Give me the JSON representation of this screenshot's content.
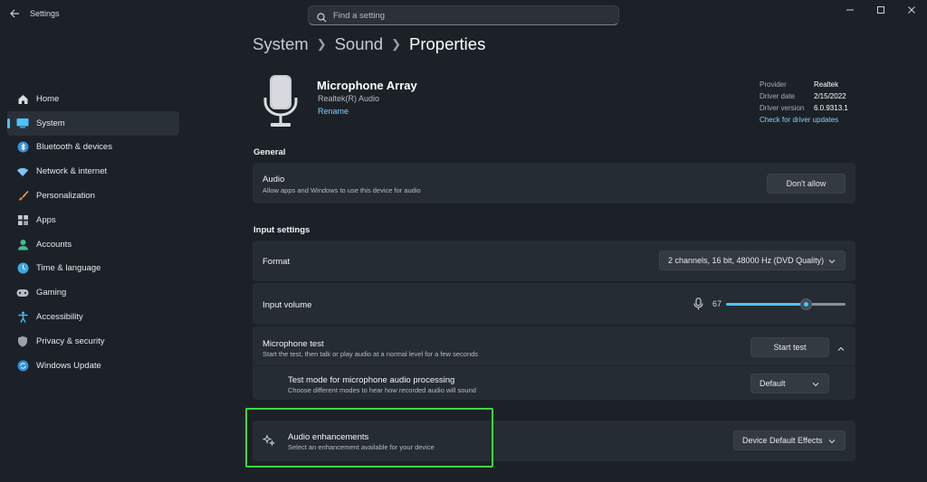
{
  "app": {
    "title": "Settings"
  },
  "search": {
    "placeholder": "Find a setting"
  },
  "sidebar": {
    "items": [
      {
        "label": "Home",
        "icon": "home-icon"
      },
      {
        "label": "System",
        "icon": "system-icon",
        "active": true
      },
      {
        "label": "Bluetooth & devices",
        "icon": "bluetooth-icon"
      },
      {
        "label": "Network & internet",
        "icon": "wifi-icon"
      },
      {
        "label": "Personalization",
        "icon": "brush-icon"
      },
      {
        "label": "Apps",
        "icon": "apps-icon"
      },
      {
        "label": "Accounts",
        "icon": "accounts-icon"
      },
      {
        "label": "Time & language",
        "icon": "globe-clock-icon"
      },
      {
        "label": "Gaming",
        "icon": "gamepad-icon"
      },
      {
        "label": "Accessibility",
        "icon": "accessibility-icon"
      },
      {
        "label": "Privacy & security",
        "icon": "shield-icon"
      },
      {
        "label": "Windows Update",
        "icon": "update-icon"
      }
    ]
  },
  "breadcrumb": [
    "System",
    "Sound",
    "Properties"
  ],
  "device": {
    "name": "Microphone Array",
    "driver_name": "Realtek(R) Audio",
    "rename_label": "Rename",
    "provider_label": "Provider",
    "provider_value": "Realtek",
    "date_label": "Driver date",
    "date_value": "2/15/2022",
    "version_label": "Driver version",
    "version_value": "6.0.9313.1",
    "update_link": "Check for driver updates"
  },
  "general": {
    "heading": "General",
    "audio_title": "Audio",
    "audio_desc": "Allow apps and Windows to use this device for audio",
    "audio_button": "Don't allow"
  },
  "input": {
    "heading": "Input settings",
    "format_title": "Format",
    "format_value": "2 channels, 16 bit, 48000 Hz (DVD Quality)",
    "volume_title": "Input volume",
    "volume_value": "67",
    "volume_level": 67,
    "mictest_title": "Microphone test",
    "mictest_desc": "Start the test, then talk or play audio at a normal level for a few seconds",
    "mictest_button": "Start test",
    "testmode_title": "Test mode for microphone audio processing",
    "testmode_desc": "Choose different modes to hear how recorded audio will sound",
    "testmode_value": "Default",
    "enh_title": "Audio enhancements",
    "enh_desc": "Select an enhancement available for your device",
    "enh_value": "Device Default Effects"
  },
  "colors": {
    "accent": "#4cc2ff",
    "highlight": "#3ed93e"
  }
}
